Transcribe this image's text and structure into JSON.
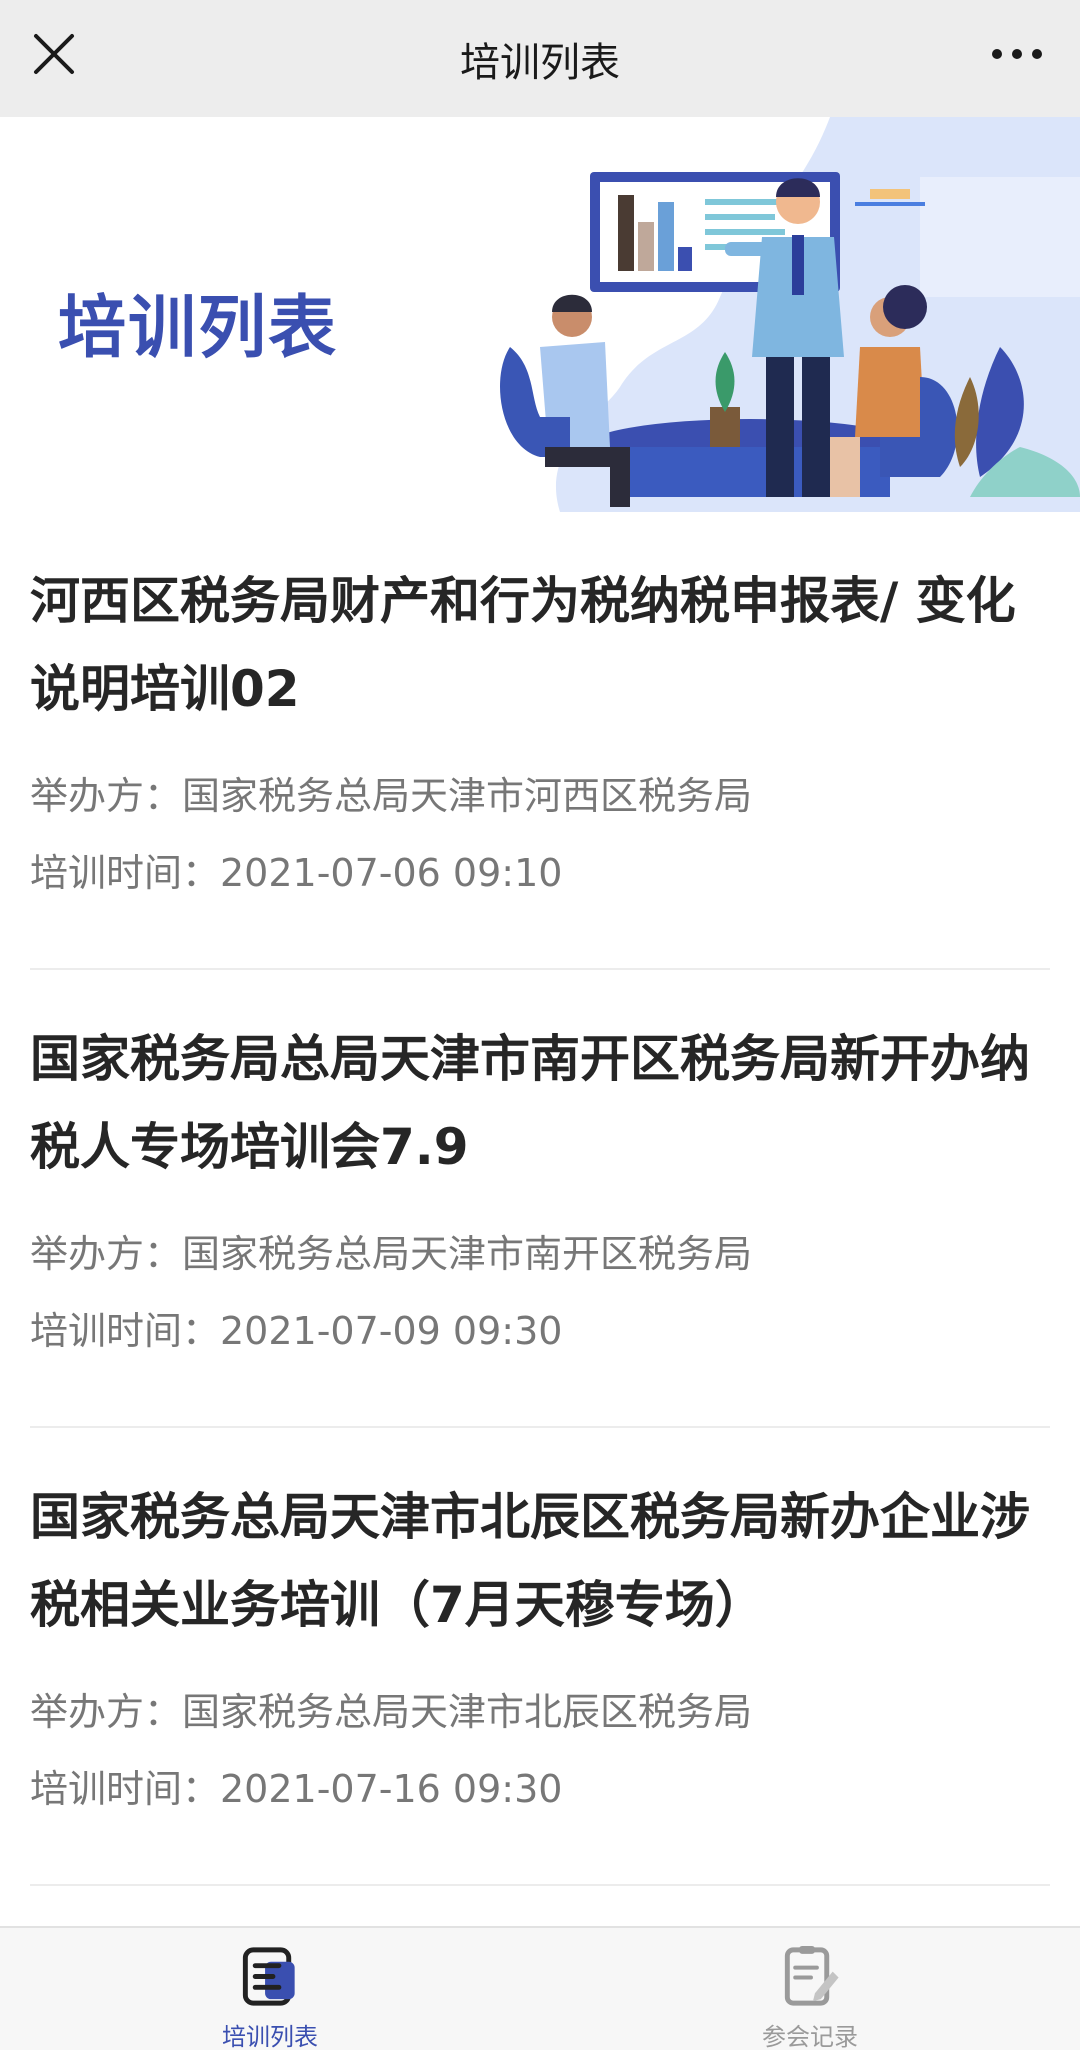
{
  "header": {
    "title": "培训列表"
  },
  "banner": {
    "title": "培训列表"
  },
  "trainings": [
    {
      "title": "河西区税务局财产和行为税纳税申报表/ 变化说明培训02",
      "organizer": "举办方：国家税务总局天津市河西区税务局",
      "time": "培训时间：2021-07-06 09:10"
    },
    {
      "title": "国家税务局总局天津市南开区税务局新开办纳税人专场培训会7.9",
      "organizer": "举办方：国家税务总局天津市南开区税务局",
      "time": "培训时间：2021-07-09 09:30"
    },
    {
      "title": "国家税务总局天津市北辰区税务局新办企业涉税相关业务培训（7月天穆专场）",
      "organizer": "举办方：国家税务总局天津市北辰区税务局",
      "time": "培训时间：2021-07-16 09:30"
    }
  ],
  "tabs": [
    {
      "label": "培训列表",
      "icon": "list-doc-icon",
      "active": true
    },
    {
      "label": "参会记录",
      "icon": "record-edit-icon",
      "active": false
    }
  ],
  "colors": {
    "accent": "#3a4fb0",
    "topbar": "#ededed",
    "muted_text": "#777777"
  }
}
